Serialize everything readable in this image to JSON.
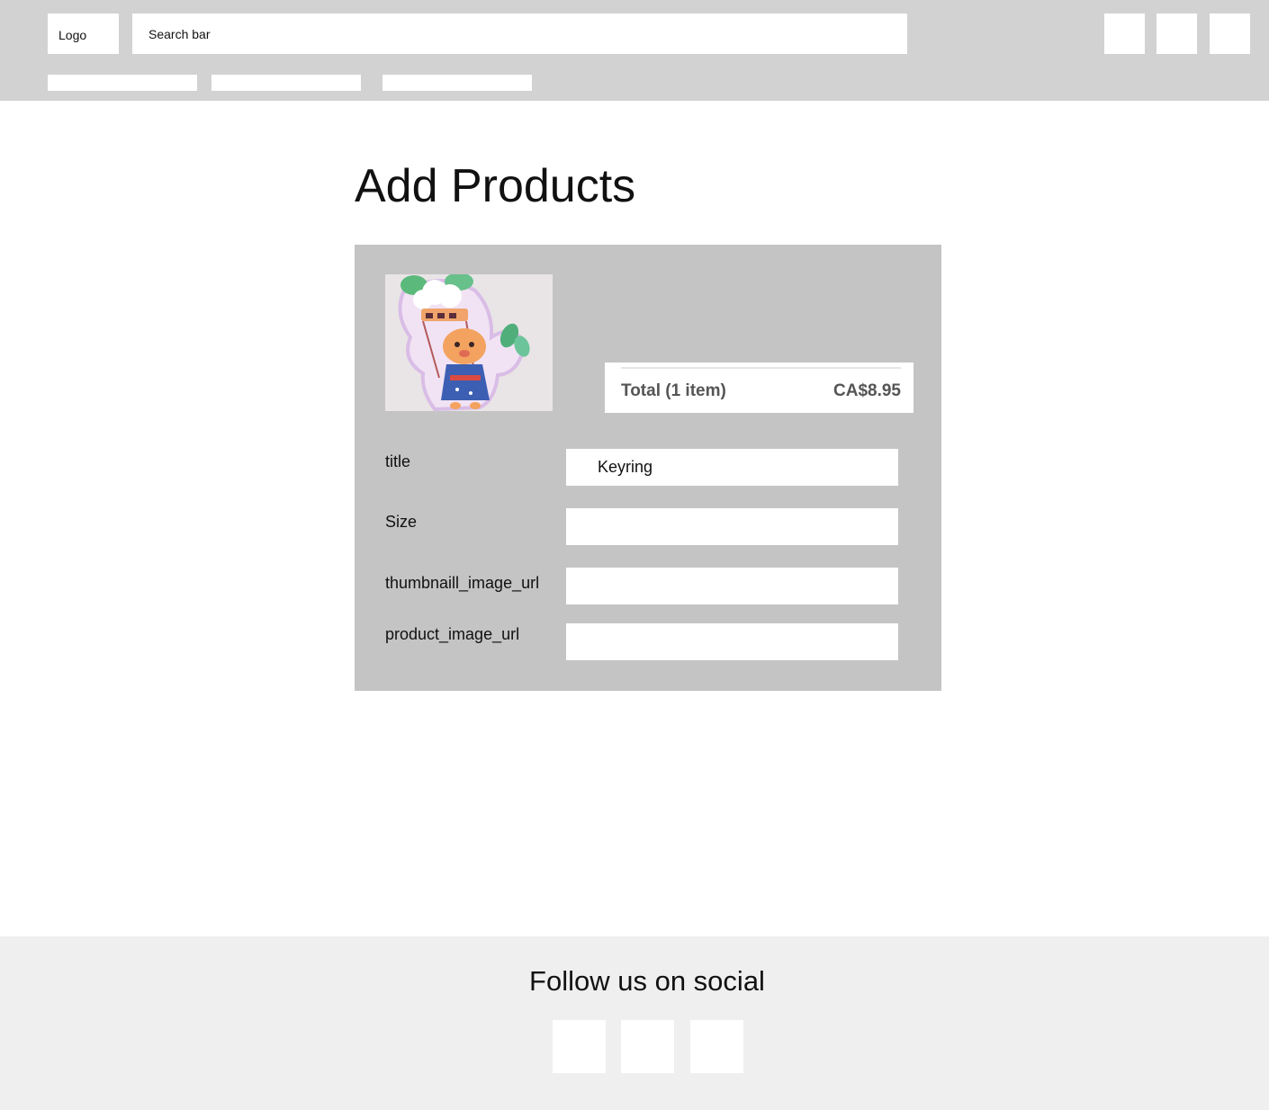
{
  "header": {
    "logo_label": "Logo",
    "search_placeholder": "Search bar",
    "icons": [
      "header-icon-1",
      "header-icon-2",
      "header-icon-3"
    ],
    "nav_items": [
      "",
      "",
      ""
    ]
  },
  "main": {
    "title": "Add Products",
    "product_image": "product-photo",
    "summary": {
      "total_label": "Total (1 item)",
      "total_price": "CA$8.95"
    },
    "fields": [
      {
        "label": "title",
        "value": "Keyring"
      },
      {
        "label": "Size",
        "value": ""
      },
      {
        "label": "thumbnaill_image_url",
        "value": ""
      },
      {
        "label": "product_image_url",
        "value": ""
      }
    ]
  },
  "footer": {
    "title": "Follow us on social",
    "social_icons": [
      "social-icon-1",
      "social-icon-2",
      "social-icon-3"
    ]
  },
  "colors": {
    "header_bg": "#d2d2d2",
    "panel_bg": "#c4c4c4",
    "footer_bg": "#efefef"
  }
}
